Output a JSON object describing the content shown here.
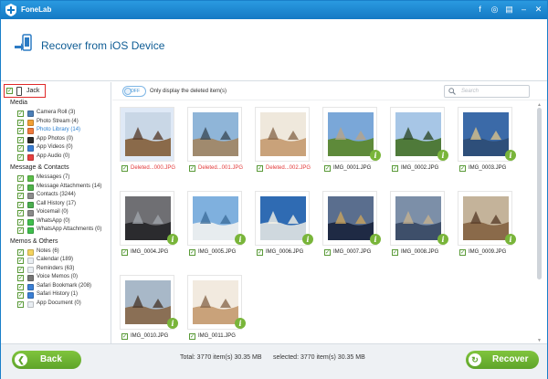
{
  "app": {
    "title": "FoneLab",
    "icon": "fonelab-logo-icon"
  },
  "title_controls": [
    {
      "name": "facebook-icon",
      "glyph": "f"
    },
    {
      "name": "chat-icon",
      "glyph": "◎"
    },
    {
      "name": "feedback-icon",
      "glyph": "▤"
    },
    {
      "name": "minimize-icon",
      "glyph": "–"
    },
    {
      "name": "close-icon",
      "glyph": "✕"
    }
  ],
  "header": {
    "title": "Recover from iOS Device"
  },
  "device": {
    "label": "Jack",
    "checked": true
  },
  "sidebar": {
    "sections": [
      {
        "title": "Media",
        "items": [
          {
            "label": "Camera Roll (3)",
            "icon": "camera-roll-icon",
            "color": "#4c7fb8",
            "selected": false
          },
          {
            "label": "Photo Stream (4)",
            "icon": "photo-stream-icon",
            "color": "#f2a035",
            "selected": false
          },
          {
            "label": "Photo Library (14)",
            "icon": "photo-library-icon",
            "color": "#f07a3b",
            "selected": true
          },
          {
            "label": "App Photos (0)",
            "icon": "app-photos-icon",
            "color": "#2b2b2b",
            "selected": false
          },
          {
            "label": "App Videos (0)",
            "icon": "app-videos-icon",
            "color": "#3a7fd5",
            "selected": false
          },
          {
            "label": "App Audio (0)",
            "icon": "app-audio-icon",
            "color": "#e84040",
            "selected": false
          }
        ]
      },
      {
        "title": "Message & Contacts",
        "items": [
          {
            "label": "Messages (7)",
            "icon": "messages-icon",
            "color": "#5cc04a",
            "selected": false
          },
          {
            "label": "Message Attachments (14)",
            "icon": "message-attachments-icon",
            "color": "#4fb34a",
            "selected": false
          },
          {
            "label": "Contacts (3244)",
            "icon": "contacts-icon",
            "color": "#8d8d8d",
            "selected": false
          },
          {
            "label": "Call History (17)",
            "icon": "call-history-icon",
            "color": "#4caf50",
            "selected": false
          },
          {
            "label": "Voicemail (0)",
            "icon": "voicemail-icon",
            "color": "#8a8a8a",
            "selected": false
          },
          {
            "label": "WhatsApp (0)",
            "icon": "whatsapp-icon",
            "color": "#3fbf4d",
            "selected": false
          },
          {
            "label": "WhatsApp Attachments (0)",
            "icon": "whatsapp-attachments-icon",
            "color": "#3fbf4d",
            "selected": false
          }
        ]
      },
      {
        "title": "Memos & Others",
        "items": [
          {
            "label": "Notes (6)",
            "icon": "notes-icon",
            "color": "#f4d35e",
            "selected": false
          },
          {
            "label": "Calendar (189)",
            "icon": "calendar-icon",
            "color": "#e9eef3",
            "selected": false
          },
          {
            "label": "Reminders (63)",
            "icon": "reminders-icon",
            "color": "#e9eef3",
            "selected": false
          },
          {
            "label": "Voice Memos (0)",
            "icon": "voice-memos-icon",
            "color": "#777777",
            "selected": false
          },
          {
            "label": "Safari Bookmark (208)",
            "icon": "safari-bookmark-icon",
            "color": "#3a7fd5",
            "selected": false
          },
          {
            "label": "Safari History (1)",
            "icon": "safari-history-icon",
            "color": "#3a7fd5",
            "selected": false
          },
          {
            "label": "App Document (0)",
            "icon": "app-document-icon",
            "color": "#e9eef3",
            "selected": false
          }
        ]
      }
    ]
  },
  "toolbar": {
    "toggle_label": "OFF",
    "only_deleted_label": "Only display the deleted item(s)",
    "search_placeholder": "Search"
  },
  "photos": [
    {
      "name": "Deleted...000.JPG",
      "deleted": true,
      "selected": true,
      "sky": "#c9d7e6",
      "ground": "#8a6a4a",
      "accent": "#5a4030"
    },
    {
      "name": "Deleted...001.JPG",
      "deleted": true,
      "selected": false,
      "sky": "#8fb5d8",
      "ground": "#a08a6e",
      "accent": "#3b4c5a"
    },
    {
      "name": "Deleted...002.JPG",
      "deleted": true,
      "selected": false,
      "sky": "#efe8dc",
      "ground": "#c9a27a",
      "accent": "#8a6a4f"
    },
    {
      "name": "IMG_0001.JPG",
      "deleted": false,
      "selected": false,
      "sky": "#7aa7d8",
      "ground": "#5e8a3a",
      "accent": "#b7a48a"
    },
    {
      "name": "IMG_0002.JPG",
      "deleted": false,
      "selected": false,
      "sky": "#a7c6e6",
      "ground": "#4f7a3a",
      "accent": "#2f4a2a"
    },
    {
      "name": "IMG_0003.JPG",
      "deleted": false,
      "selected": false,
      "sky": "#3b6aa8",
      "ground": "#2e4f7a",
      "accent": "#d9c28a"
    },
    {
      "name": "IMG_0004.JPG",
      "deleted": false,
      "selected": false,
      "sky": "#6f6f73",
      "ground": "#2b2b2e",
      "accent": "#9fa4aa"
    },
    {
      "name": "IMG_0005.JPG",
      "deleted": false,
      "selected": false,
      "sky": "#7fb0de",
      "ground": "#e7ecef",
      "accent": "#3e6f9c"
    },
    {
      "name": "IMG_0006.JPG",
      "deleted": false,
      "selected": false,
      "sky": "#2f6bb3",
      "ground": "#cfd8de",
      "accent": "#f4f1e6"
    },
    {
      "name": "IMG_0007.JPG",
      "deleted": false,
      "selected": false,
      "sky": "#5a6e8e",
      "ground": "#1f2a44",
      "accent": "#c9a25c"
    },
    {
      "name": "IMG_0008.JPG",
      "deleted": false,
      "selected": false,
      "sky": "#7c8fa8",
      "ground": "#3e4f6a",
      "accent": "#c4b08e"
    },
    {
      "name": "IMG_0009.JPG",
      "deleted": false,
      "selected": false,
      "sky": "#c4b39a",
      "ground": "#8a6a4a",
      "accent": "#5a3e2a"
    },
    {
      "name": "IMG_0010.JPG",
      "deleted": false,
      "selected": false,
      "sky": "#a8b8c8",
      "ground": "#8a6f55",
      "accent": "#4a3a2e"
    },
    {
      "name": "IMG_0011.JPG",
      "deleted": false,
      "selected": false,
      "sky": "#f2eadf",
      "ground": "#c9a27a",
      "accent": "#8a6a4f"
    }
  ],
  "footer": {
    "back_label": "Back",
    "recover_label": "Recover",
    "total_text": "Total: 3770 item(s) 30.35 MB",
    "selected_text": "selected: 3770 item(s) 30.35 MB"
  },
  "colors": {
    "titlebar": "#1a86d0",
    "accent_green": "#6cb033",
    "deleted_red": "#e23838"
  }
}
